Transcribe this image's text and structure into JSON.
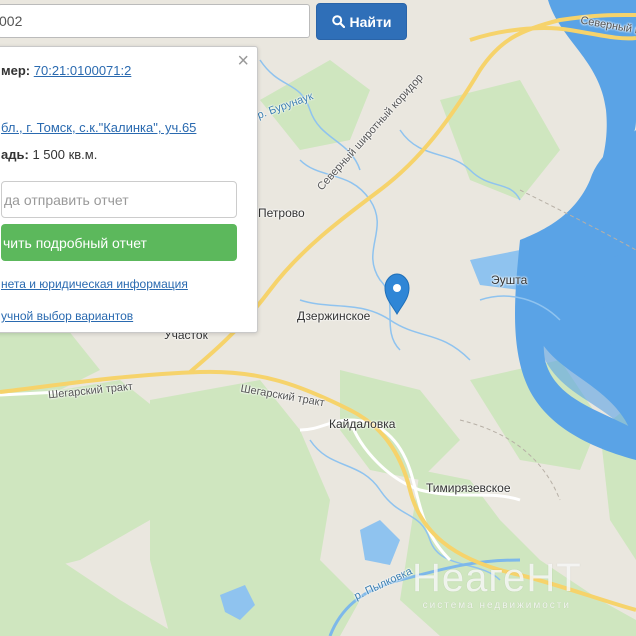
{
  "search": {
    "value": "002",
    "button_label": "Найти"
  },
  "panel": {
    "number_label": "мер:",
    "number_value": "70:21:0100071:2",
    "address_value": "бл., г. Томск, с.к.\"Калинка\", уч.65",
    "area_label": "адь:",
    "area_value": "1 500 кв.м.",
    "email_placeholder": "да отправить отчет",
    "report_button_label": "чить подробный отчет",
    "link_legal": "нета и юридическая информация",
    "link_manual": "учной выбор вариантов"
  },
  "map": {
    "labels": {
      "petrovo": "Петрово",
      "dzerzhinskoe": "Дзержинское",
      "eushta": "Эушта",
      "uchastok": "Участок",
      "kaidalovka": "Кайдаловка",
      "timiryazevskoe": "Тимирязевское",
      "shegarsky1": "Шегарский тракт",
      "shegarsky2": "Шегарский тракт",
      "corridor": "Северный широтный коридор",
      "north_top": "Северный ш",
      "burunduk": "р. Бурунаук",
      "pylkovka": "р. Пылковка"
    },
    "marker_icon": "map-pin-icon",
    "colors": {
      "land": "#eae7df",
      "forest": "#cfe6bf",
      "water": "#5aa3e6",
      "road": "#f6d36b",
      "pin": "#2f86d6"
    }
  },
  "watermark": {
    "logo": "НеагеНТ",
    "subtitle": "система недвижимости"
  }
}
